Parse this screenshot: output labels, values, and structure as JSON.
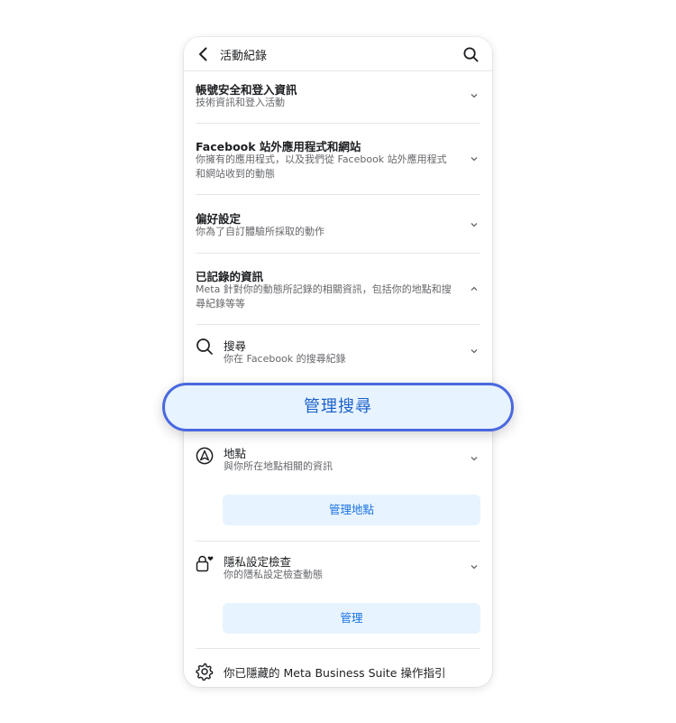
{
  "header": {
    "title": "活動紀錄"
  },
  "sections": [
    {
      "title": "帳號安全和登入資訊",
      "desc": "技術資訊和登入活動"
    },
    {
      "title": "Facebook 站外應用程式和網站",
      "desc": "你擁有的應用程式，以及我們從 Facebook 站外應用程式和網站收到的動態"
    },
    {
      "title": "偏好設定",
      "desc": "你為了自訂體驗所採取的動作"
    },
    {
      "title": "已記錄的資訊",
      "desc": "Meta 針對你的動態所記錄的相關資訊，包括你的地點和搜尋紀錄等等"
    }
  ],
  "subitems": [
    {
      "title": "搜尋",
      "desc": "你在 Facebook 的搜尋紀錄",
      "icon": "search-icon"
    },
    {
      "title": "地點",
      "desc": "與你所在地點相關的資訊",
      "icon": "location-icon",
      "button": "管理地點"
    },
    {
      "title": "隱私設定檢查",
      "desc": "你的隱私設定檢查動態",
      "icon": "lock-heart-icon",
      "button": "管理"
    },
    {
      "title": "你已隱藏的 Meta Business Suite 操作指引",
      "icon": "gear-icon"
    }
  ],
  "highlight": {
    "label": "管理搜尋"
  },
  "colors": {
    "accent": "#1b74e4",
    "button_bg": "#e7f3ff",
    "highlight_border": "#4a68e0"
  }
}
